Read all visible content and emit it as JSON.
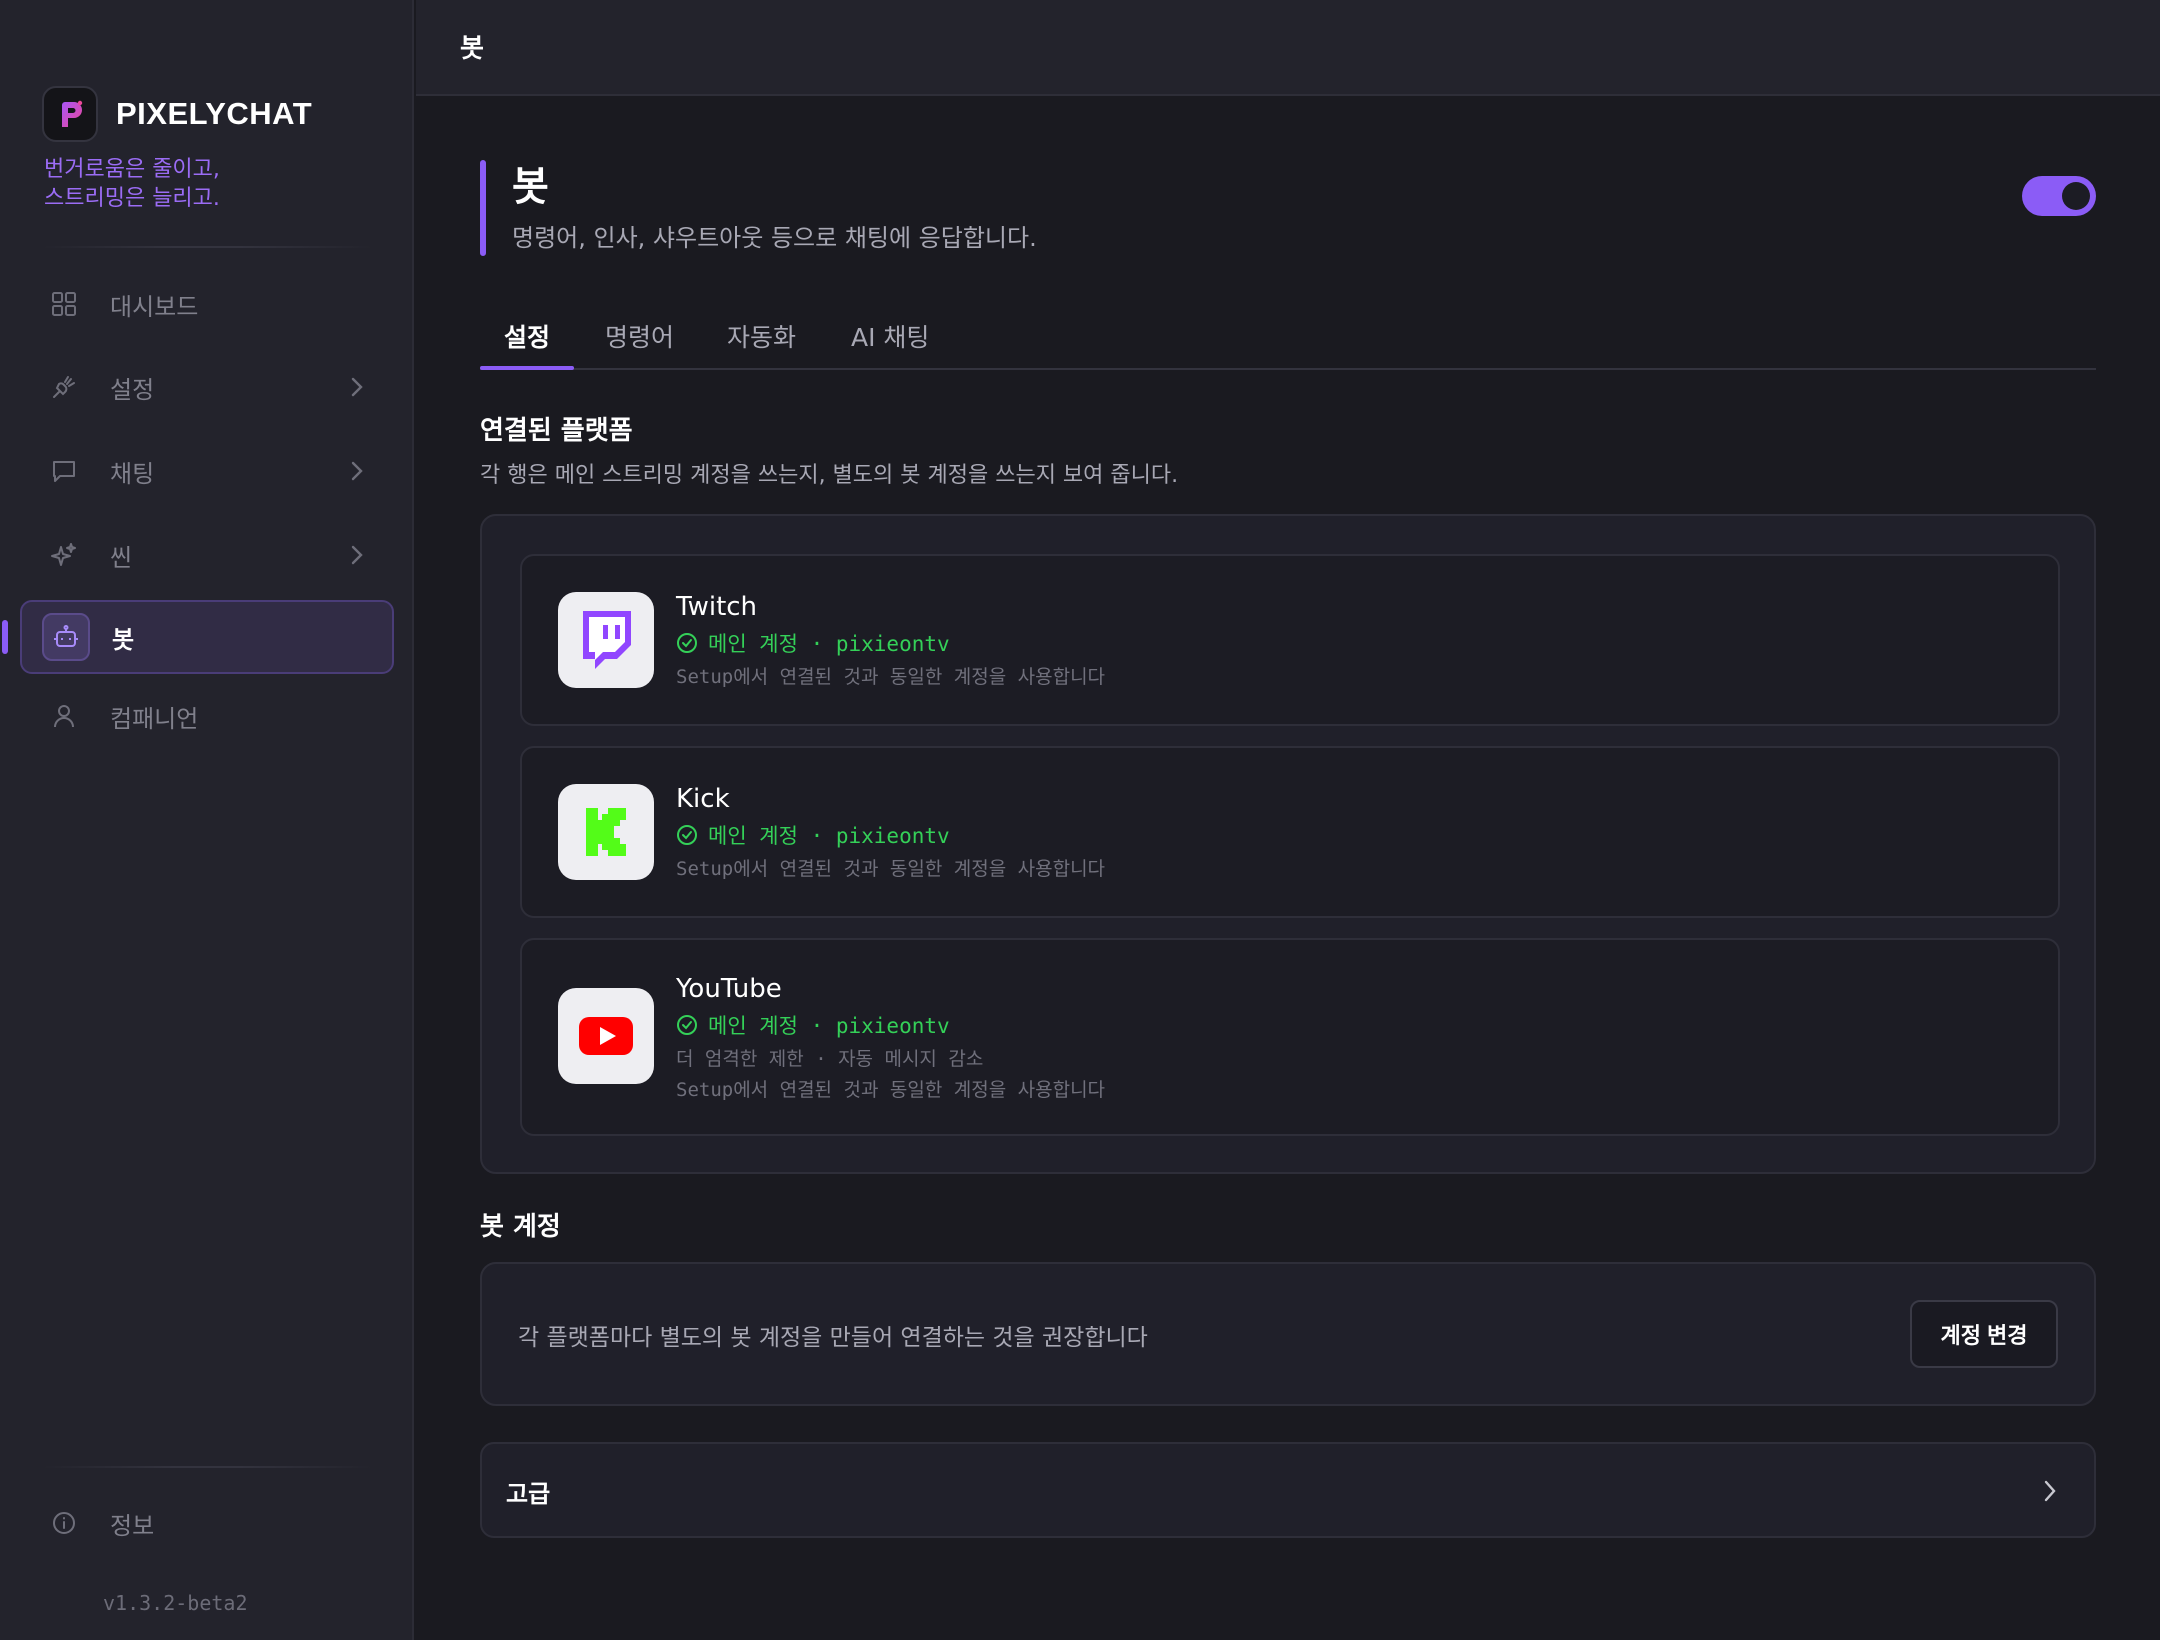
{
  "app": {
    "brand_name": "PIXELYCHAT",
    "tagline_line1": "번거로움은 줄이고,",
    "tagline_line2": "스트리밍은 늘리고.",
    "version": "v1.3.2-beta2"
  },
  "sidebar": {
    "items": [
      {
        "label": "대시보드",
        "icon": "grid-icon"
      },
      {
        "label": "설정",
        "icon": "plug-icon"
      },
      {
        "label": "채팅",
        "icon": "chat-bubble-icon"
      },
      {
        "label": "씬",
        "icon": "sparkles-icon"
      },
      {
        "label": "봇",
        "icon": "robot-icon",
        "active": true
      },
      {
        "label": "컴패니언",
        "icon": "user-icon"
      }
    ],
    "footer_item": {
      "label": "정보",
      "icon": "info-icon"
    }
  },
  "topbar": {
    "title": "봇"
  },
  "header": {
    "title": "봇",
    "description": "명령어, 인사, 샤우트아웃 등으로 채팅에 응답합니다.",
    "enabled": true
  },
  "tabs": [
    {
      "label": "설정",
      "active": true
    },
    {
      "label": "명령어"
    },
    {
      "label": "자동화"
    },
    {
      "label": "AI 채팅"
    }
  ],
  "connected": {
    "title": "연결된 플랫폼",
    "description": "각 행은 메인 스트리밍 계정을 쓰는지, 별도의 봇 계정을 쓰는지 보여 줍니다.",
    "platforms": [
      {
        "name": "Twitch",
        "status": "메인 계정 · pixieontv",
        "notes": [
          "Setup에서 연결된 것과 동일한 계정을 사용합니다"
        ],
        "icon": "twitch-icon"
      },
      {
        "name": "Kick",
        "status": "메인 계정 · pixieontv",
        "notes": [
          "Setup에서 연결된 것과 동일한 계정을 사용합니다"
        ],
        "icon": "kick-icon"
      },
      {
        "name": "YouTube",
        "status": "메인 계정 · pixieontv",
        "notes": [
          "더 엄격한 제한 · 자동 메시지 감소",
          "Setup에서 연결된 것과 동일한 계정을 사용합니다"
        ],
        "icon": "youtube-icon"
      }
    ]
  },
  "bot_account": {
    "title": "봇 계정",
    "description": "각 플랫폼마다 별도의 봇 계정을 만들어 연결하는 것을 권장합니다",
    "button_label": "계정 변경"
  },
  "advanced": {
    "label": "고급"
  },
  "colors": {
    "accent": "#8b5cf6",
    "status_green": "#34d058",
    "background": "#1a1a20",
    "sidebar": "#23232c"
  }
}
